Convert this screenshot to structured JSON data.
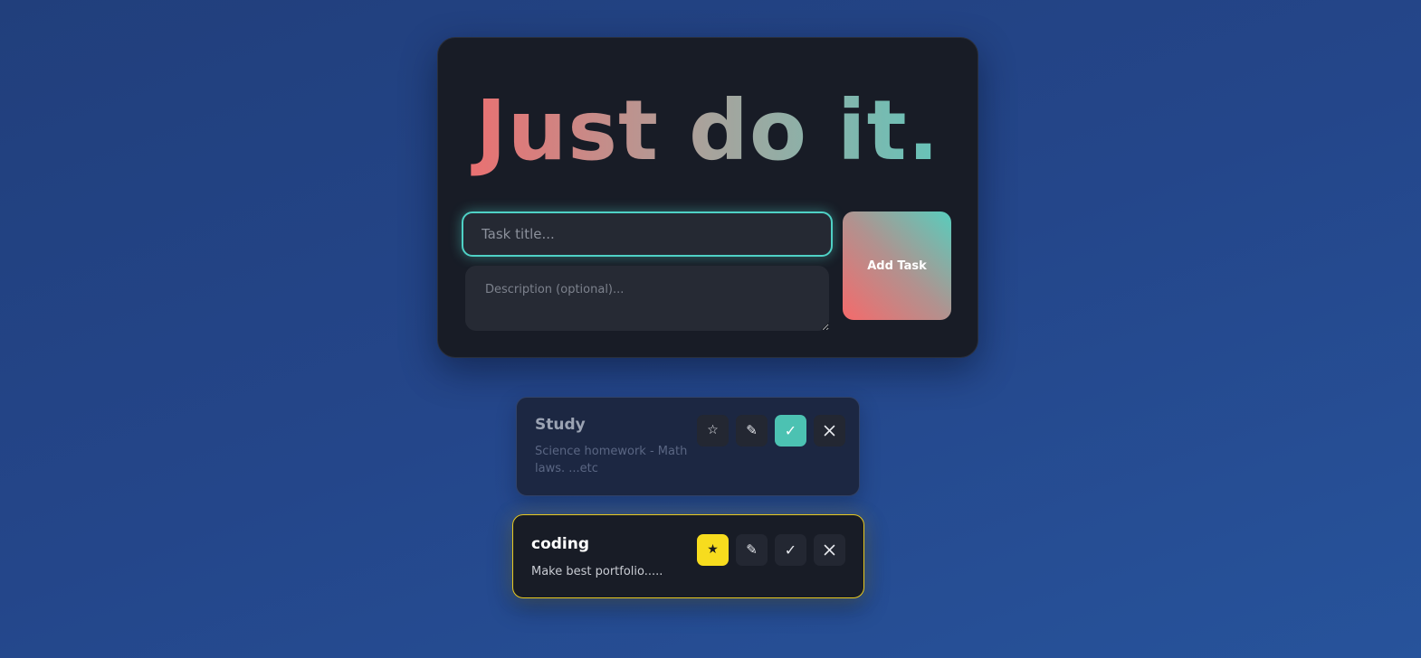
{
  "header": {
    "title": "Just do it."
  },
  "form": {
    "title_placeholder": "Task title...",
    "description_placeholder": "Description (optional)...",
    "add_button_label": "Add Task"
  },
  "tasks": [
    {
      "title": "Study",
      "description": "Science homework - Math laws. ...etc",
      "starred": false,
      "completed": true,
      "icons": [
        "star-outline-icon",
        "pencil-icon",
        "checkmark-icon",
        "close-icon"
      ]
    },
    {
      "title": "coding",
      "description": "Make best portfolio.....",
      "starred": true,
      "completed": false,
      "icons": [
        "star-filled-icon",
        "pencil-icon",
        "checkmark-icon",
        "close-icon"
      ]
    }
  ],
  "glyphs": {
    "star_outline": "☆",
    "star_filled": "★",
    "edit": "✎",
    "check": "✓"
  },
  "colors": {
    "accent_teal": "#4fd1c5",
    "accent_coral": "#f26a6c",
    "star_yellow": "#f7dc1e",
    "card_bg": "#181c26",
    "page_bg": "#24468a"
  }
}
